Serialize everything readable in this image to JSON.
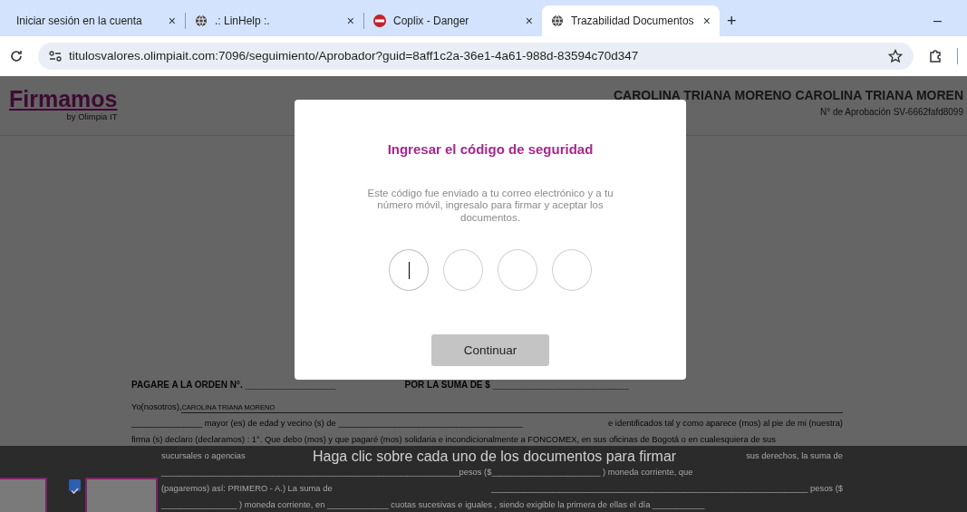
{
  "tabs": [
    {
      "label": "Iniciar sesión en la cuenta",
      "kind": "plain",
      "close": "×",
      "selected": false
    },
    {
      "label": ".: LinHelp :.",
      "kind": "site",
      "close": "×",
      "selected": false
    },
    {
      "label": "Coplix - Danger",
      "kind": "alert",
      "close": "×",
      "selected": false
    },
    {
      "label": "Trazabilidad Documentos",
      "kind": "site",
      "close": "×",
      "selected": true
    }
  ],
  "new_tab": "+",
  "minimize": "–",
  "address_bar": {
    "url": "titulosvalores.olimpiait.com:7096/seguimiento/Aprobador?guid=8aff1c2a-36e1-4a61-988d-83594c70d347"
  },
  "header": {
    "logo": "Firmamos",
    "logo_sub": "by Olimpia IT",
    "signer": "CAROLINA TRIANA MORENO CAROLINA TRIANA MOREN",
    "approval": "N° de Aprobación SV-6662fafd8099"
  },
  "document": {
    "heading_left": "PAGARE A LA ORDEN N°. __________________",
    "heading_right": "POR LA SUMA DE $ ___________________________",
    "lines": [
      {
        "kind": "signer",
        "segments": [
          "Yo(nosotros),",
          "CAROLINA TRIANA MORENO"
        ]
      },
      {
        "kind": "text",
        "segments": [
          "_______________ mayor (es) de edad y vecino (s) de _______________________________________",
          "e identificados tal y como aparece (mos) al pie de mi (nuestra)"
        ]
      },
      {
        "kind": "text",
        "segments": [
          "firma (s) declaro (declaramos) : 1°. Que debo (mos) y que pagaré (mos) solidaria e incondicionalmente a FONCOMEX, en sus oficinas de Bogotá o en cualesquiera de sus"
        ]
      },
      {
        "kind": "indent",
        "segments": [
          "sucursales o agencias",
          "sus derechos, la suma de"
        ]
      },
      {
        "kind": "indent",
        "segments": [
          "_______________________________________________________________pesos ($_______________________ ) moneda corriente, que"
        ]
      },
      {
        "kind": "indent",
        "segments": [
          "(pagaremos) así: PRIMERO - A.) La suma de",
          "___________________________________________________________________ pesos ($"
        ]
      },
      {
        "kind": "indent",
        "segments": [
          "________________ ) moneda corriente, en _____________ cuotas sucesivas e iguales , siendo exigible la primera de ellas el día ___________"
        ]
      }
    ]
  },
  "bottom_bar": {
    "text": "Haga clic sobre cada uno de los documentos para firmar",
    "documents": [
      {
        "kind": "cut"
      },
      {
        "kind": "full",
        "checked": true
      }
    ]
  },
  "modal": {
    "title": "Ingresar el código de seguridad",
    "message": "Este código fue enviado a tu correo electrónico y a tu número móvil, ingresalo para firmar y aceptar los documentos.",
    "code_fields": [
      {
        "focused": true
      },
      {
        "focused": false
      },
      {
        "focused": false
      },
      {
        "focused": false
      }
    ],
    "button": "Continuar"
  }
}
